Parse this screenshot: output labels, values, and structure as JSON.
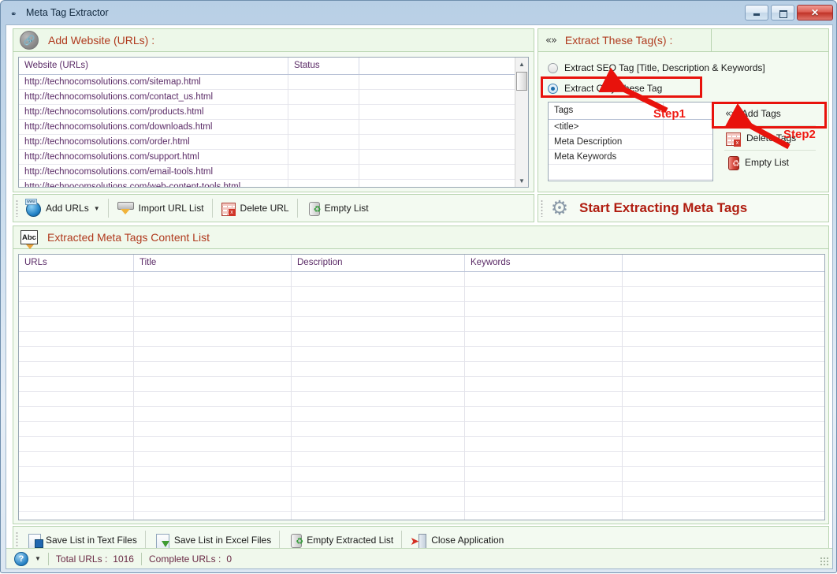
{
  "window": {
    "title": "Meta Tag Extractor",
    "icon": "app-icon",
    "minimize_label": "",
    "maximize_label": "",
    "close_label": "✕"
  },
  "add_website_panel": {
    "header_title": "Add Website (URLs) :",
    "header_icon": "link-icon",
    "grid": {
      "columns": [
        "Website (URLs)",
        "Status",
        ""
      ],
      "rows": [
        [
          "http://technocomsolutions.com/sitemap.html",
          "",
          ""
        ],
        [
          "http://technocomsolutions.com/contact_us.html",
          "",
          ""
        ],
        [
          "http://technocomsolutions.com/products.html",
          "",
          ""
        ],
        [
          "http://technocomsolutions.com/downloads.html",
          "",
          ""
        ],
        [
          "http://technocomsolutions.com/order.html",
          "",
          ""
        ],
        [
          "http://technocomsolutions.com/support.html",
          "",
          ""
        ],
        [
          "http://technocomsolutions.com/email-tools.html",
          "",
          ""
        ],
        [
          "http://technocomsolutions.com/web-content-tools.html",
          "",
          ""
        ]
      ]
    },
    "toolbar": {
      "add_urls": "Add URLs",
      "add_urls_icon": "globe-icon",
      "import_url_list": "Import URL List",
      "import_icon": "import-icon",
      "delete_url": "Delete URL",
      "delete_icon": "table-delete-icon",
      "empty_list": "Empty List",
      "empty_icon": "recycle-bin-icon"
    }
  },
  "extract_tags_panel": {
    "header_title": "Extract These Tag(s) :",
    "header_icon": "code-brackets-icon",
    "options": [
      {
        "label": "Extract SEO Tag [Title, Description & Keywords]",
        "selected": false
      },
      {
        "label": "Extract Only These Tag",
        "selected": true
      }
    ],
    "tags_grid": {
      "columns": [
        "Tags",
        ""
      ],
      "rows": [
        "<title>",
        "Meta Description",
        "Meta Keywords"
      ]
    },
    "actions": [
      {
        "label": "Add Tags",
        "icon": "code-brackets-icon"
      },
      {
        "label": "Delete Tags",
        "icon": "table-delete-icon"
      },
      {
        "label": "Empty List",
        "icon": "recycle-bin-red-icon"
      }
    ],
    "start_button": {
      "label": "Start Extracting Meta Tags",
      "icon": "gear-icon"
    }
  },
  "extracted_panel": {
    "header_title": "Extracted Meta Tags Content List",
    "header_icon": "abc-icon",
    "columns": [
      "URLs",
      "Title",
      "Description",
      "Keywords",
      ""
    ],
    "rows": [],
    "toolbar": {
      "save_text": "Save List in Text Files",
      "save_text_icon": "save-document-icon",
      "save_excel": "Save List in Excel Files",
      "save_excel_icon": "save-excel-icon",
      "empty_extracted": "Empty Extracted List",
      "empty_extracted_icon": "recycle-bin-icon",
      "close_app": "Close Application",
      "close_app_icon": "exit-door-icon"
    }
  },
  "status_bar": {
    "help_icon": "help-icon",
    "dropdown_icon": "chevron-down-icon",
    "total_urls_label": "Total URLs :",
    "total_urls_value": "1016",
    "complete_urls_label": "Complete URLs :",
    "complete_urls_value": "0"
  },
  "annotations": {
    "step1": "Step1",
    "step2": "Step2",
    "color": "#e8120c"
  }
}
